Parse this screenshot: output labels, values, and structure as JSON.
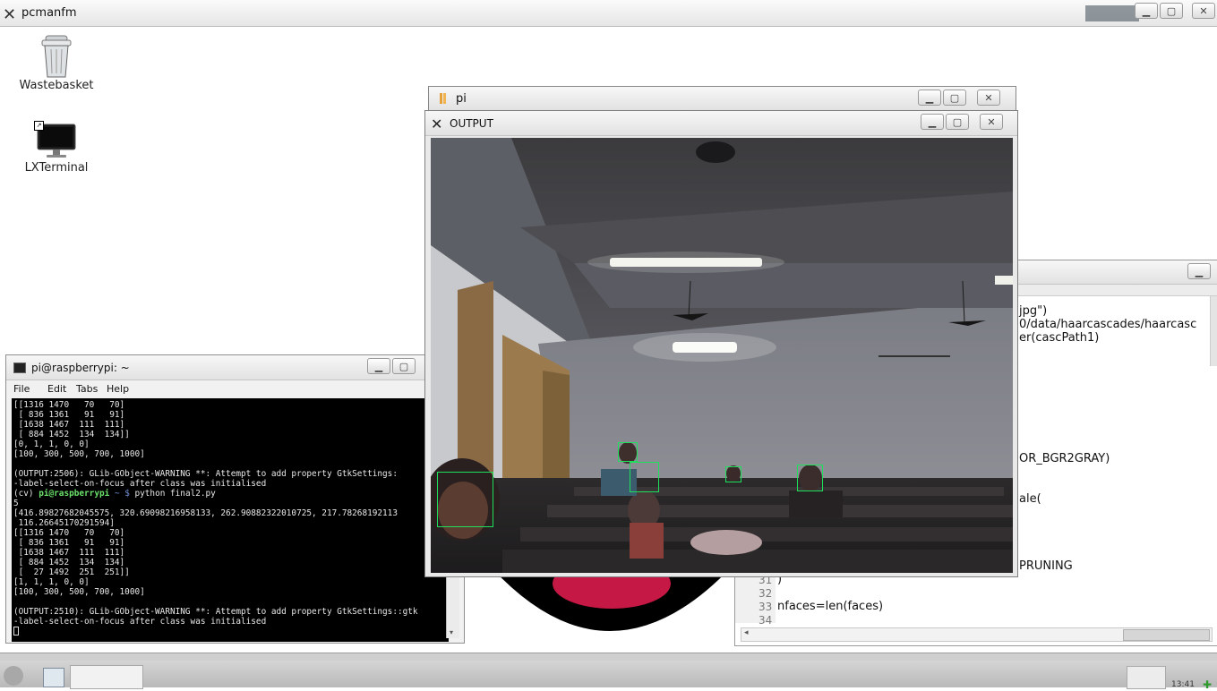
{
  "desktop": {
    "window_title": "pcmanfm",
    "icons": [
      {
        "label": "Wastebasket",
        "icon": "trash-icon"
      },
      {
        "label": "LXTerminal",
        "icon": "monitor-icon"
      }
    ]
  },
  "pi_window": {
    "title": "pi"
  },
  "output_window": {
    "title": "OUTPUT"
  },
  "terminal": {
    "title": "pi@raspberrypi: ~",
    "menu": [
      "File",
      "Edit",
      "Tabs",
      "Help"
    ],
    "lines": [
      "[[1316 1470   70   70]",
      " [ 836 1361   91   91]",
      " [1638 1467  111  111]",
      " [ 884 1452  134  134]]",
      "[0, 1, 1, 0, 0]",
      "[100, 300, 500, 700, 1000]",
      "",
      "(OUTPUT:2506): GLib-GObject-WARNING **: Attempt to add property GtkSettings:",
      "-label-select-on-focus after class was initialised",
      "__PROMPT__",
      "5",
      "[416.89827682045575, 320.69098216958133, 262.90882322010725, 217.78268192113",
      " 116.26645170291594]",
      "[[1316 1470   70   70]",
      " [ 836 1361   91   91]",
      " [1638 1467  111  111]",
      " [ 884 1452  134  134]",
      " [  27 1492  251  251]]",
      "[1, 1, 1, 0, 0]",
      "[100, 300, 500, 700, 1000]",
      "",
      "(OUTPUT:2510): GLib-GObject-WARNING **: Attempt to add property GtkSettings::gtk",
      "-label-select-on-focus after class was initialised"
    ],
    "prompt": {
      "env": "(cv)",
      "user": "pi@raspberrypi",
      "path": "~ $",
      "command": "python final2.py"
    }
  },
  "editor": {
    "code_fragments": [
      "jpg\")",
      "0/data/haarcascades/haarcasc",
      "er(cascPath1)",
      "OR_BGR2GRAY)",
      "ale(",
      "PRUNING"
    ],
    "numbered_lines": [
      {
        "num": "31",
        "text": ")"
      },
      {
        "num": "32",
        "text": ""
      },
      {
        "num": "33",
        "text": "nfaces=len(faces)"
      },
      {
        "num": "34",
        "text": ""
      }
    ]
  },
  "taskbar": {
    "clock": "13:41"
  },
  "colors": {
    "face_box": "#1ee05a",
    "terminal_bg": "#000000",
    "prompt_green": "#6ce26c"
  }
}
